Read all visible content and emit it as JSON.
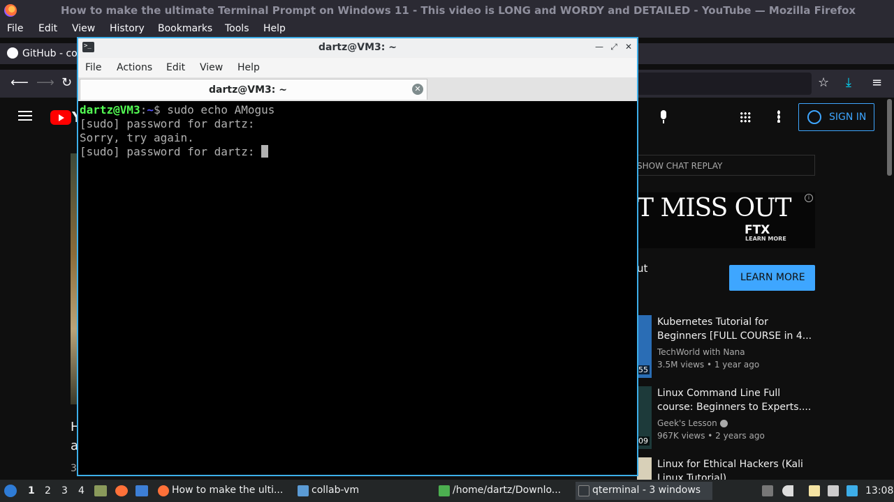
{
  "firefox": {
    "window_title": "How to make the ultimate Terminal Prompt on Windows 11 - This video is LONG and WORDY and DETAILED - YouTube — Mozilla Firefox",
    "menu": [
      "File",
      "Edit",
      "View",
      "History",
      "Bookmarks",
      "Tools",
      "Help"
    ],
    "bookmark": "GitHub - cor"
  },
  "youtube": {
    "logo_fragment": "Y",
    "sign_in": "SIGN IN",
    "show_chat_replay": "SHOW CHAT REPLAY",
    "ad_headline_fragment": "T MISS OUT",
    "ad_brand": "FTX",
    "ad_subtext": "LEARN MORE",
    "ad_body_fragment": "ut",
    "learn_more": "LEARN MORE",
    "video_title_line1": "H",
    "video_title_line2": "a",
    "video_views_fragment": "3",
    "related": [
      {
        "title1": "Kubernetes Tutorial for",
        "title2": "Beginners [FULL COURSE in 4...",
        "channel": "TechWorld with Nana",
        "meta": "3.5M views • 1 year ago",
        "duration_fragment": "55"
      },
      {
        "title1": "Linux Command Line Full",
        "title2": "course: Beginners to Experts....",
        "channel": "Geek's Lesson",
        "meta": "967K views • 2 years ago",
        "duration_fragment": "09"
      },
      {
        "title1": "Linux for Ethical Hackers (Kali",
        "title2": "Linux Tutorial)",
        "channel": "",
        "meta": "",
        "duration_fragment": ""
      }
    ]
  },
  "terminal": {
    "window_title": "dartz@VM3: ~",
    "menu": [
      "File",
      "Actions",
      "Edit",
      "View",
      "Help"
    ],
    "tab_label": "dartz@VM3: ~",
    "prompt_user": "dartz@VM3",
    "prompt_sep": ":",
    "prompt_dir": "~",
    "prompt_symbol": "$ ",
    "command": "sudo echo AMogus",
    "output": [
      "[sudo] password for dartz:",
      "Sorry, try again.",
      "[sudo] password for dartz: "
    ]
  },
  "panel": {
    "workspaces": [
      "1",
      "2",
      "3",
      "4"
    ],
    "tasks": [
      {
        "label": "How to make the ulti...",
        "icon": "firefox-icon"
      },
      {
        "label": "collab-vm",
        "icon": "folder-icon"
      },
      {
        "label": "/home/dartz/Downlo...",
        "icon": "archive-icon"
      },
      {
        "label": "qterminal - 3 windows",
        "icon": "terminal-icon"
      }
    ],
    "clock": "13:08"
  },
  "colors": {
    "accent": "#3daee9",
    "youtube_blue": "#3ea6ff",
    "prompt_user": "#54ff54",
    "prompt_dir": "#5454ff"
  }
}
